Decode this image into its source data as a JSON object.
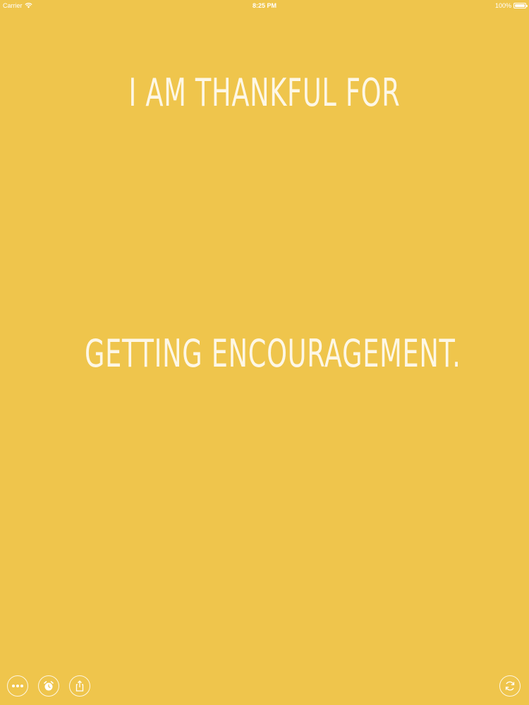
{
  "status_bar": {
    "carrier": "Carrier",
    "time": "8:25 PM",
    "battery": "100%"
  },
  "content": {
    "prompt": "I AM THANKFUL FOR",
    "answer": "GETTING ENCOURAGEMENT."
  },
  "toolbar": {
    "more_icon": "ellipsis-icon",
    "alarm_icon": "alarm-clock-icon",
    "share_icon": "share-icon",
    "refresh_icon": "refresh-icon"
  },
  "colors": {
    "background": "#efc54c",
    "text": "#fdf7e6"
  }
}
